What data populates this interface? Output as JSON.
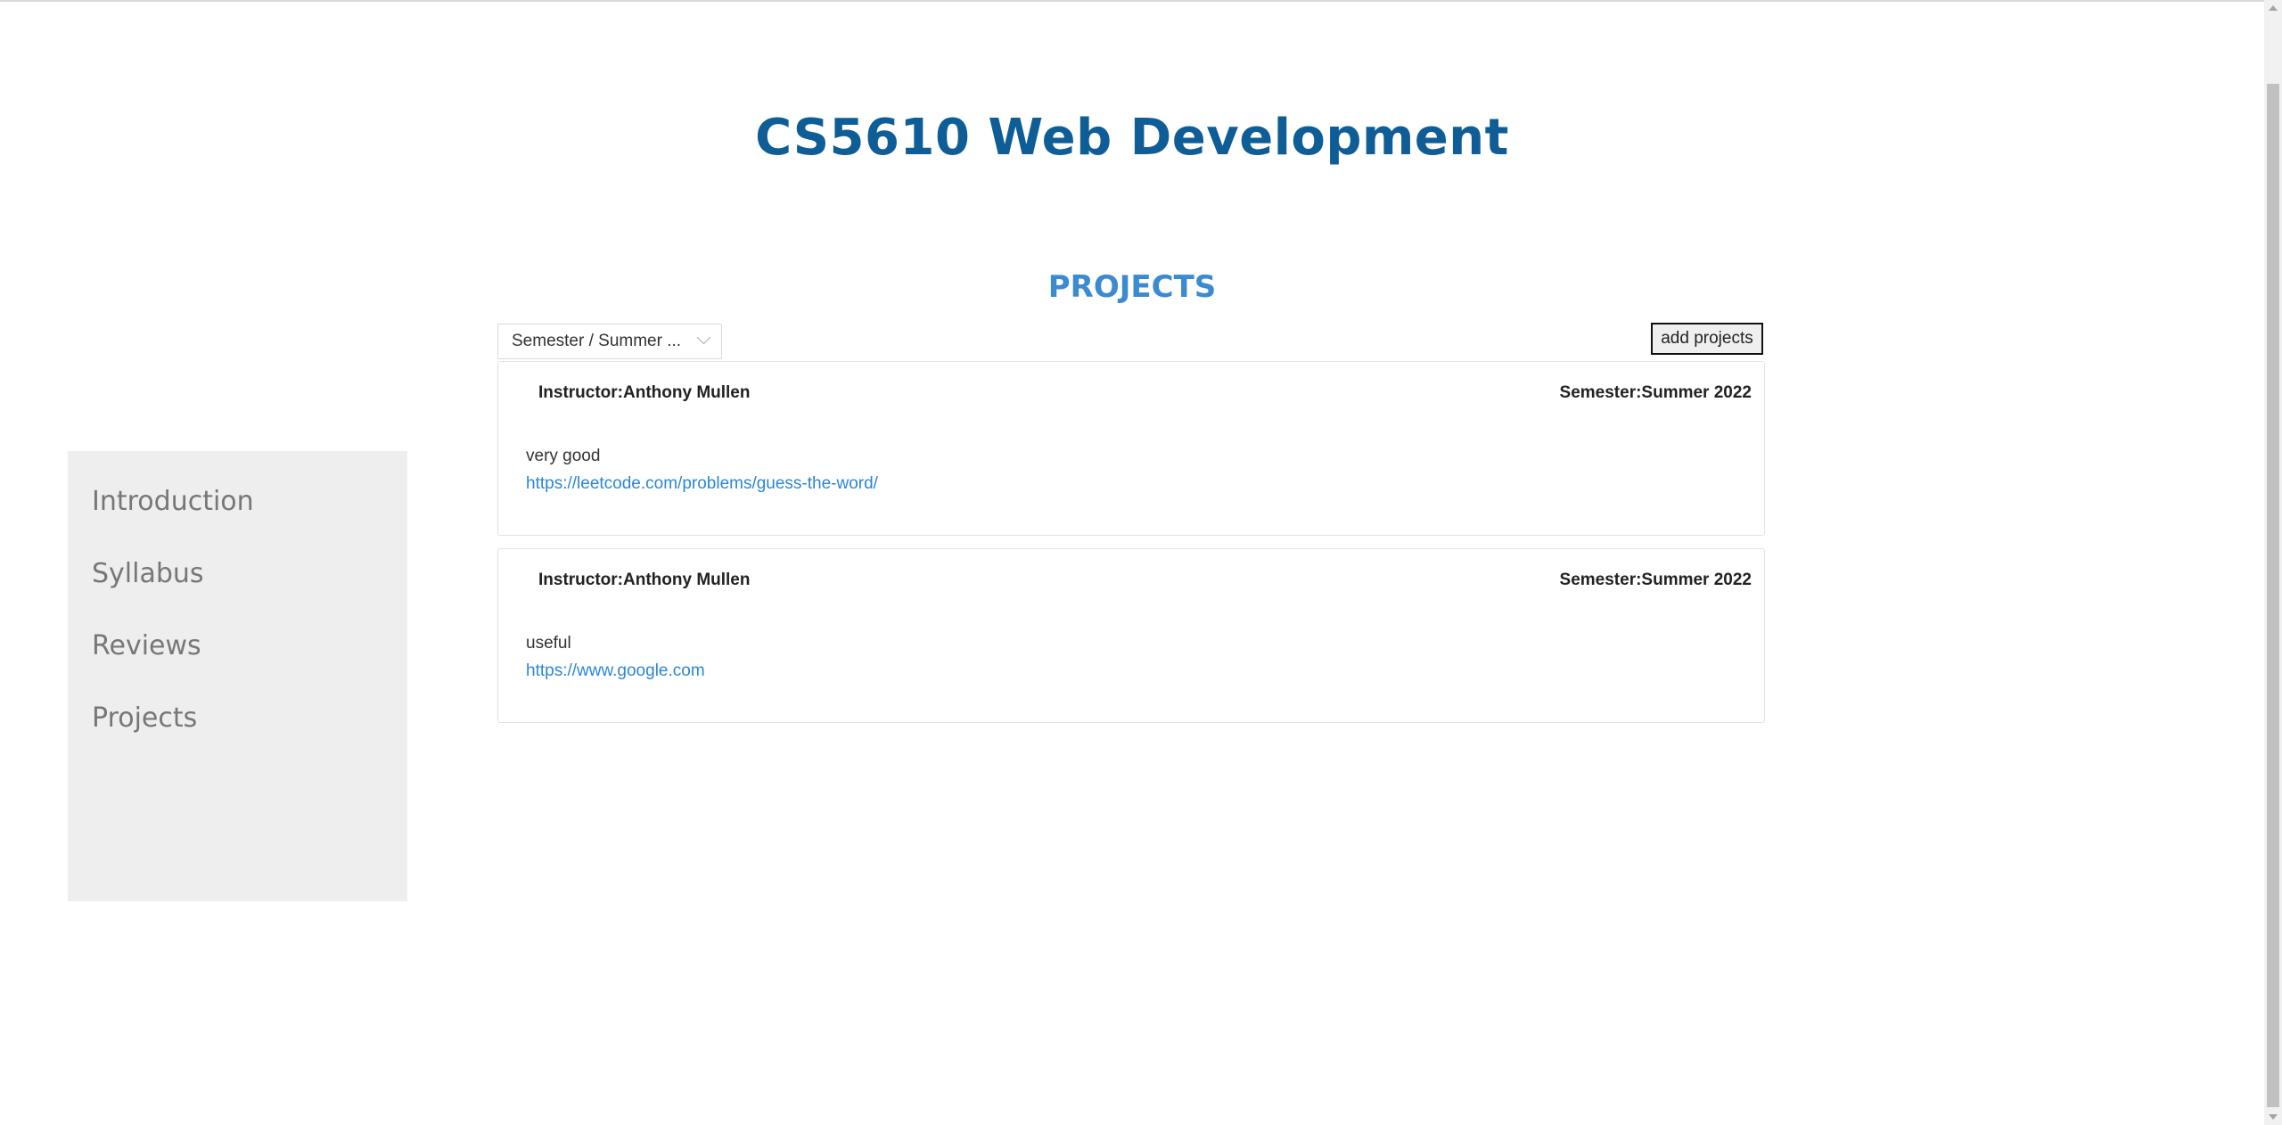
{
  "header": {
    "title": "CS5610 Web Development"
  },
  "sidebar": {
    "items": [
      {
        "label": "Introduction"
      },
      {
        "label": "Syllabus"
      },
      {
        "label": "Reviews"
      },
      {
        "label": "Projects"
      }
    ]
  },
  "main": {
    "section_title": "PROJECTS",
    "semester_select": {
      "value": "Semester / Summer ..."
    },
    "add_button_label": "add projects",
    "projects": [
      {
        "instructor": "Instructor:Anthony Mullen",
        "semester": "Semester:Summer 2022",
        "description": "very good",
        "link": "https://leetcode.com/problems/guess-the-word/"
      },
      {
        "instructor": "Instructor:Anthony Mullen",
        "semester": "Semester:Summer 2022",
        "description": "useful",
        "link": "https://www.google.com"
      }
    ]
  },
  "colors": {
    "title": "#0f5d96",
    "section_title": "#3b8bd1",
    "link": "#2b86d6",
    "sidebar_bg": "#eeeeee"
  },
  "icons": {
    "select_arrow": "chevron-down-icon"
  }
}
